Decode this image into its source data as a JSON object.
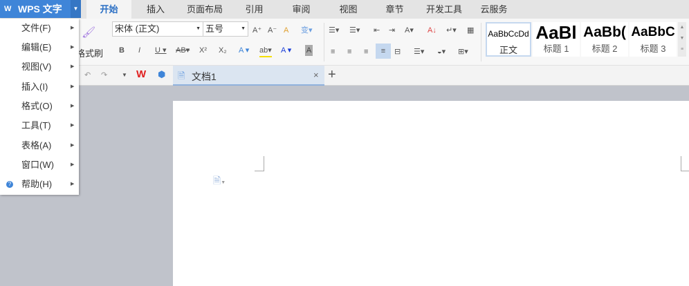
{
  "app": {
    "title": "WPS 文字",
    "logo": "W"
  },
  "tabs": [
    "开始",
    "插入",
    "页面布局",
    "引用",
    "审阅",
    "视图",
    "章节",
    "开发工具",
    "云服务"
  ],
  "ribbon": {
    "format_painter": "格式刷",
    "font": "宋体 (正文)",
    "size": "五号",
    "styles": [
      {
        "sample": "AaBbCcDd",
        "name": "正文"
      },
      {
        "sample": "AaBl",
        "name": "标题 1"
      },
      {
        "sample": "AaBb(",
        "name": "标题 2"
      },
      {
        "sample": "AaBbC",
        "name": "标题 3"
      }
    ]
  },
  "doc_tab": {
    "name": "文档1"
  },
  "menu": [
    {
      "label": "文件(F)"
    },
    {
      "label": "编辑(E)"
    },
    {
      "label": "视图(V)"
    },
    {
      "label": "插入(I)"
    },
    {
      "label": "格式(O)"
    },
    {
      "label": "工具(T)"
    },
    {
      "label": "表格(A)"
    },
    {
      "label": "窗口(W)"
    },
    {
      "label": "帮助(H)",
      "icon": "help-icon"
    }
  ],
  "colors": {
    "accent": "#3f85d8",
    "workspace": "#c0c3cb"
  }
}
